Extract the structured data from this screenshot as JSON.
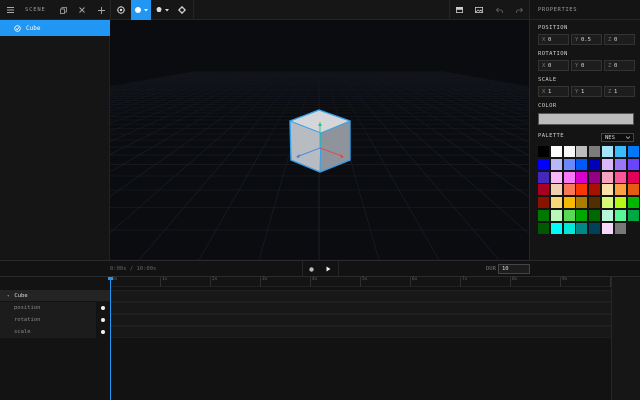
{
  "toolbar": {
    "scene_label": "SCENE",
    "icons": [
      "hamburger-menu-icon",
      "copy-icon",
      "close-icon",
      "add-icon",
      "target-icon",
      "sphere-icon",
      "light-icon",
      "settings-icon",
      "layout-icon",
      "photo-icon",
      "undo-icon",
      "redo-icon"
    ]
  },
  "outliner": {
    "items": [
      {
        "label": "Cube",
        "selected": true
      }
    ]
  },
  "properties": {
    "header": "PROPERTIES",
    "position": {
      "title": "POSITION",
      "x": "0",
      "y": "0.5",
      "z": "0"
    },
    "rotation": {
      "title": "ROTATION",
      "x": "0",
      "y": "0",
      "z": "0"
    },
    "scale": {
      "title": "SCALE",
      "x": "1",
      "y": "1",
      "z": "1"
    },
    "axis_labels": {
      "x": "X",
      "y": "Y",
      "z": "Z"
    },
    "color": {
      "title": "COLOR",
      "value": "#bcbcbc"
    },
    "palette": {
      "title": "PALETTE",
      "selected": "NES",
      "swatches": [
        "#000000",
        "#fcfcfc",
        "#f8f8f8",
        "#bcbcbc",
        "#7c7c7c",
        "#a4e4fc",
        "#3cbcfc",
        "#0078f8",
        "#0000fc",
        "#b8b8f8",
        "#6888fc",
        "#0058f8",
        "#0000bc",
        "#d8b8f8",
        "#9878f8",
        "#6844fc",
        "#4428bc",
        "#f8b8f8",
        "#f878f8",
        "#d800cc",
        "#940084",
        "#f8a4c0",
        "#f85898",
        "#e40058",
        "#a80020",
        "#f0d0b0",
        "#f87858",
        "#f83800",
        "#a81000",
        "#fce0a8",
        "#fca044",
        "#e45c10",
        "#881400",
        "#f8d878",
        "#f8b800",
        "#ac7c00",
        "#503000",
        "#d8f878",
        "#b8f818",
        "#00b800",
        "#007800",
        "#b8f8b8",
        "#58d854",
        "#00a800",
        "#006800",
        "#b8f8d8",
        "#58f898",
        "#00a844",
        "#005800",
        "#00fcfc",
        "#00e8d8",
        "#008888",
        "#004058",
        "#f8d8f8",
        "#787878"
      ]
    }
  },
  "timeline": {
    "time": "0:00s / 10:00s",
    "duration_label": "DUR",
    "duration": "10",
    "ticks": [
      "0s",
      "1s",
      "2s",
      "3s",
      "4s",
      "5s",
      "6s",
      "7s",
      "8s",
      "9s",
      "10s"
    ],
    "track": {
      "name": "Cube",
      "properties": [
        "position",
        "rotation",
        "scale"
      ]
    }
  }
}
